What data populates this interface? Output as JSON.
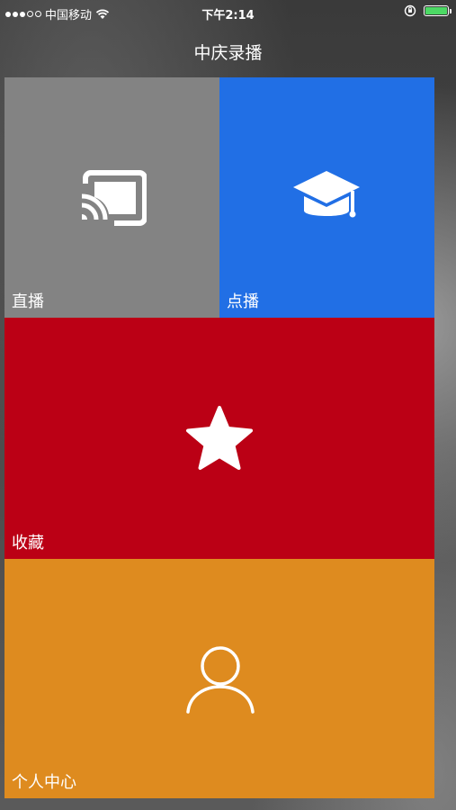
{
  "status_bar": {
    "carrier": "中国移动",
    "time": "下午2:14"
  },
  "nav": {
    "title": "中庆录播"
  },
  "tiles": [
    {
      "label": "直播",
      "icon": "cast-icon",
      "color": "#838383"
    },
    {
      "label": "点播",
      "icon": "graduation-cap-icon",
      "color": "#216fe5"
    },
    {
      "label": "收藏",
      "icon": "star-icon",
      "color": "#bb0015"
    },
    {
      "label": "个人中心",
      "icon": "user-icon",
      "color": "#de8b1f"
    }
  ]
}
